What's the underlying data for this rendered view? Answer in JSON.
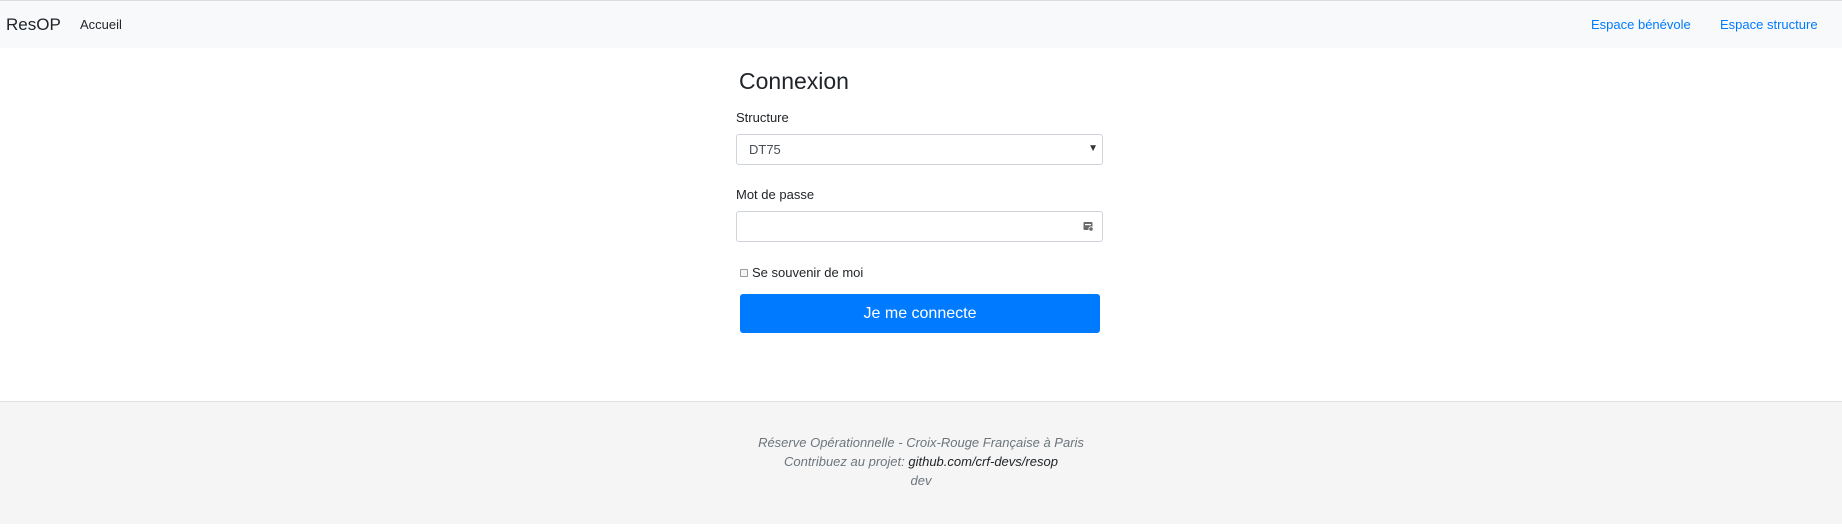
{
  "navbar": {
    "brand": "ResOP",
    "home_link": "Accueil",
    "right_links": [
      "Espace bénévole",
      "Espace structure"
    ]
  },
  "login": {
    "title": "Connexion",
    "structure_label": "Structure",
    "structure_selected": "DT75",
    "password_label": "Mot de passe",
    "password_value": "",
    "remember_label": "Se souvenir de moi",
    "remember_checked": false,
    "submit_label": "Je me connecte"
  },
  "footer": {
    "line1": "Réserve Opérationnelle - Croix-Rouge Française à Paris",
    "contribute_prefix": "Contribuez au projet:",
    "contribute_link": "github.com/crf-devs/resop",
    "environment": "dev"
  },
  "colors": {
    "primary": "#007bff",
    "navbar_bg": "#f8f9fa",
    "footer_bg": "#f5f5f5"
  },
  "icons": {
    "select_caret": "caret-down-icon",
    "password_manager": "key-icon"
  }
}
